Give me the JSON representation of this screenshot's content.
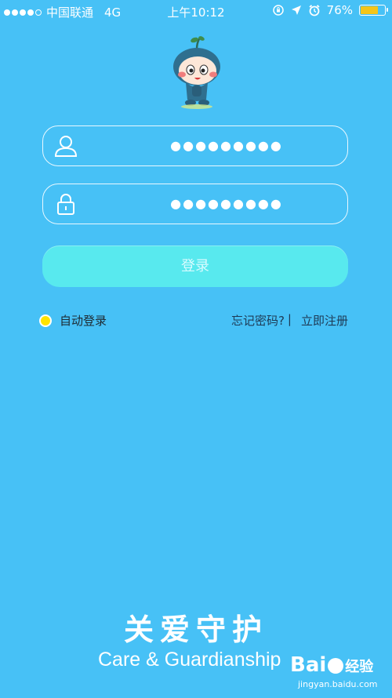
{
  "status_bar": {
    "carrier": "中国联通",
    "network": "4G",
    "time": "上午10:12",
    "battery_percent": "76%",
    "battery_level": 0.76,
    "battery_color": "#f4c518"
  },
  "username_field": {
    "icon": "user-icon",
    "masked_value": "●●●●●●●●●"
  },
  "password_field": {
    "icon": "lock-icon",
    "masked_value": "●●●●●●●●●"
  },
  "login_button": {
    "label": "登录"
  },
  "auto_login": {
    "label": "自动登录",
    "selected": true
  },
  "links": {
    "forgot_password": "忘记密码?",
    "separator": "|",
    "register": "立即注册"
  },
  "slogan": {
    "chinese": "关爱守护",
    "english": "Care & Guardianship"
  },
  "watermark": {
    "brand": "Bai",
    "brand_suffix": "经验",
    "url": "jingyan.baidu.com"
  },
  "colors": {
    "background": "#47c1f6",
    "button": "#58e9ee",
    "radio": "#ffe400"
  }
}
